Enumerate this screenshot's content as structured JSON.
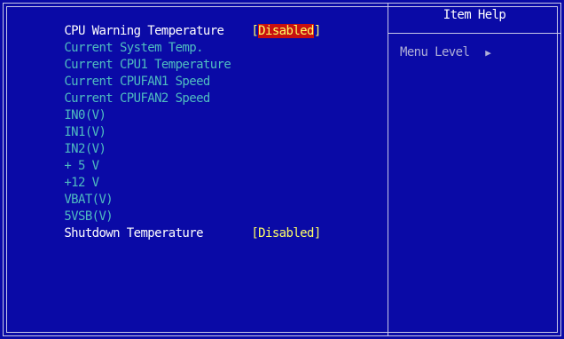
{
  "items": [
    {
      "label": "CPU Warning Temperature",
      "value": "Disabled",
      "selected": true
    },
    {
      "label": "Current System Temp."
    },
    {
      "label": "Current CPU1 Temperature"
    },
    {
      "label": "Current CPUFAN1 Speed"
    },
    {
      "label": "Current CPUFAN2 Speed"
    },
    {
      "label": "IN0(V)"
    },
    {
      "label": "IN1(V)"
    },
    {
      "label": "IN2(V)"
    },
    {
      "label": "+ 5 V"
    },
    {
      "label": "+12 V"
    },
    {
      "label": "VBAT(V)"
    },
    {
      "label": "5VSB(V)"
    },
    {
      "label": "Shutdown Temperature",
      "value": "Disabled"
    }
  ],
  "help": {
    "title": "Item Help",
    "menu_level_label": "Menu Level",
    "menu_level_arrow": "▶"
  },
  "colors": {
    "background": "#0a0aa6",
    "active_text": "#ffffff",
    "inactive_text": "#4fbcc0",
    "value_text": "#ffff66",
    "selection_bg": "#c81010"
  }
}
